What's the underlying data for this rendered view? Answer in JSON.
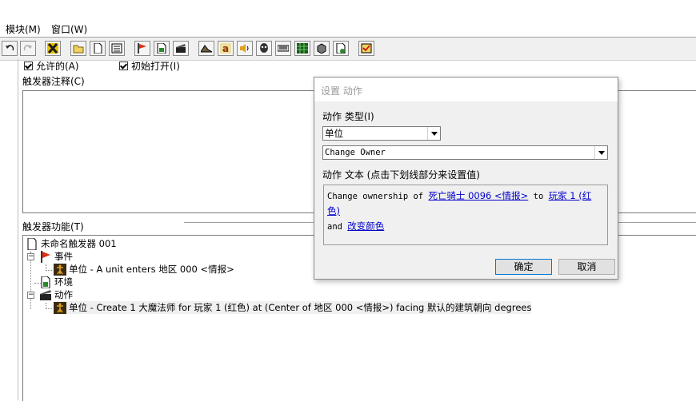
{
  "menu": {
    "module": "模块(M)",
    "window": "窗口(W)"
  },
  "toolbar": {
    "buttons": [
      "undo-icon",
      "redo-icon",
      "delete-icon",
      "open-folder-icon",
      "new-document-icon",
      "list-icon",
      "flag-icon",
      "export-icon",
      "clapper-icon",
      "terrain-icon",
      "text-a-icon",
      "sound-icon",
      "unit-icon",
      "keyboard-icon",
      "grid-icon",
      "cube-icon",
      "page-icon",
      "checklist-icon"
    ]
  },
  "options": {
    "allowed": "允许的(A)",
    "initially_on": "初始打开(I)"
  },
  "comment": {
    "label": "触发器注释(C)"
  },
  "functions": {
    "label": "触发器功能(T)"
  },
  "tree": {
    "root": "未命名触发器 001",
    "events_label": "事件",
    "event_item": "单位 - A unit enters 地区 000 <情报>",
    "conditions_label": "环境",
    "actions_label": "动作",
    "action_item": "单位 - Create 1 大魔法师 for 玩家 1 (红色) at (Center of 地区 000 <情报>) facing 默认的建筑朝向 degrees"
  },
  "dialog": {
    "title": "设置 动作",
    "type_label": "动作 类型(I)",
    "category_value": "单位",
    "action_value": "Change Owner",
    "text_label": "动作 文本 (点击下划线部分来设置值)",
    "text_prefix": "Change ownership of ",
    "link_unit": "死亡骑士 0096 <情报>",
    "text_to": " to ",
    "link_player": "玩家 1 (红色)",
    "text_and": "and ",
    "link_color": "改变颜色",
    "ok": "确定",
    "cancel": "取消"
  }
}
